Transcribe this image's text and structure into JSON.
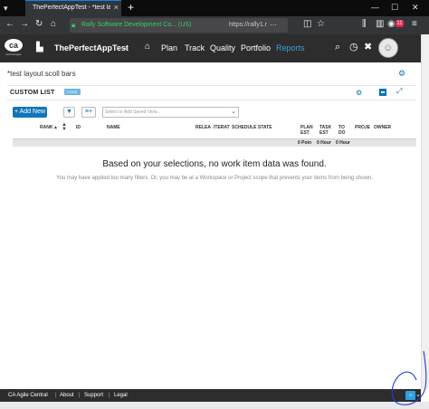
{
  "browser": {
    "tab_title": "ThePerfectAppTest - *test layo",
    "url_org": "Rally Software Development Co... (US)",
    "url_text": "https://rally1.r",
    "notification_count": "11"
  },
  "header": {
    "logo_text": "ca",
    "logo_subtext": "technologies",
    "project_name": "ThePerfectAppTest",
    "nav": [
      "Plan",
      "Track",
      "Quality",
      "Portfolio",
      "Reports"
    ],
    "active_nav": "Reports"
  },
  "page": {
    "title": "*test layout scoll bars"
  },
  "panel": {
    "title": "CUSTOM LIST",
    "badge": "CORE",
    "add_new_label": "+ Add New",
    "view_placeholder": "Select or Add Saved View..."
  },
  "grid": {
    "columns": [
      "RANK",
      "ID",
      "NAME",
      "RELEA",
      "ITERAT",
      "SCHEDULE STATE",
      "PLAN EST",
      "TASK EST",
      "TO DO",
      "PROJE",
      "OWNER"
    ],
    "summary": [
      "0 Poin",
      "0 Hour",
      "0 Hour"
    ]
  },
  "empty_state": {
    "title": "Based on your selections, no work item data was found.",
    "hint": "You may have applied too many filters. Or, you may be at a Workspace or Project scope that prevents your items from being shown."
  },
  "footer": {
    "links": [
      "CA Agile Central",
      "About",
      "Support",
      "Legal"
    ]
  },
  "colors": {
    "accent": "#0072bc",
    "header_bg": "#2d2d2d",
    "active_nav": "#39a3dc",
    "secure_green": "#2fd364",
    "ink": "#1f3fd6"
  },
  "icons": {
    "tab_menu": "tab-list-icon",
    "back": "back-arrow-icon",
    "forward": "forward-arrow-icon",
    "reload": "reload-icon",
    "home": "home-icon",
    "search": "search-icon",
    "history": "history-icon",
    "tools": "tools-icon",
    "help": "help-icon",
    "gear": "gear-icon"
  }
}
